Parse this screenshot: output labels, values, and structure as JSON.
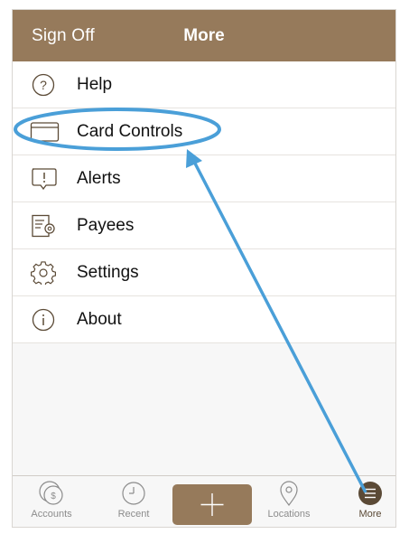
{
  "header": {
    "left_button": "Sign Off",
    "title": "More"
  },
  "menu": {
    "items": [
      {
        "label": "Help",
        "icon": "question-circle-icon"
      },
      {
        "label": "Card Controls",
        "icon": "credit-card-icon"
      },
      {
        "label": "Alerts",
        "icon": "alert-bubble-icon"
      },
      {
        "label": "Payees",
        "icon": "payees-document-gear-icon"
      },
      {
        "label": "Settings",
        "icon": "gear-icon"
      },
      {
        "label": "About",
        "icon": "info-circle-icon"
      }
    ]
  },
  "tabbar": {
    "tabs": [
      {
        "label": "Accounts",
        "icon": "accounts-coins-icon"
      },
      {
        "label": "Recent",
        "icon": "clock-icon"
      },
      {
        "label": "Locations",
        "icon": "location-pin-icon"
      },
      {
        "label": "More",
        "icon": "hamburger-menu-icon",
        "active": true
      }
    ],
    "add_button_icon": "plus-icon"
  },
  "annotation": {
    "highlight_target": "Card Controls",
    "color": "#4a9fd8"
  },
  "colors": {
    "brand": "#967a5b",
    "annotation": "#4a9fd8"
  }
}
